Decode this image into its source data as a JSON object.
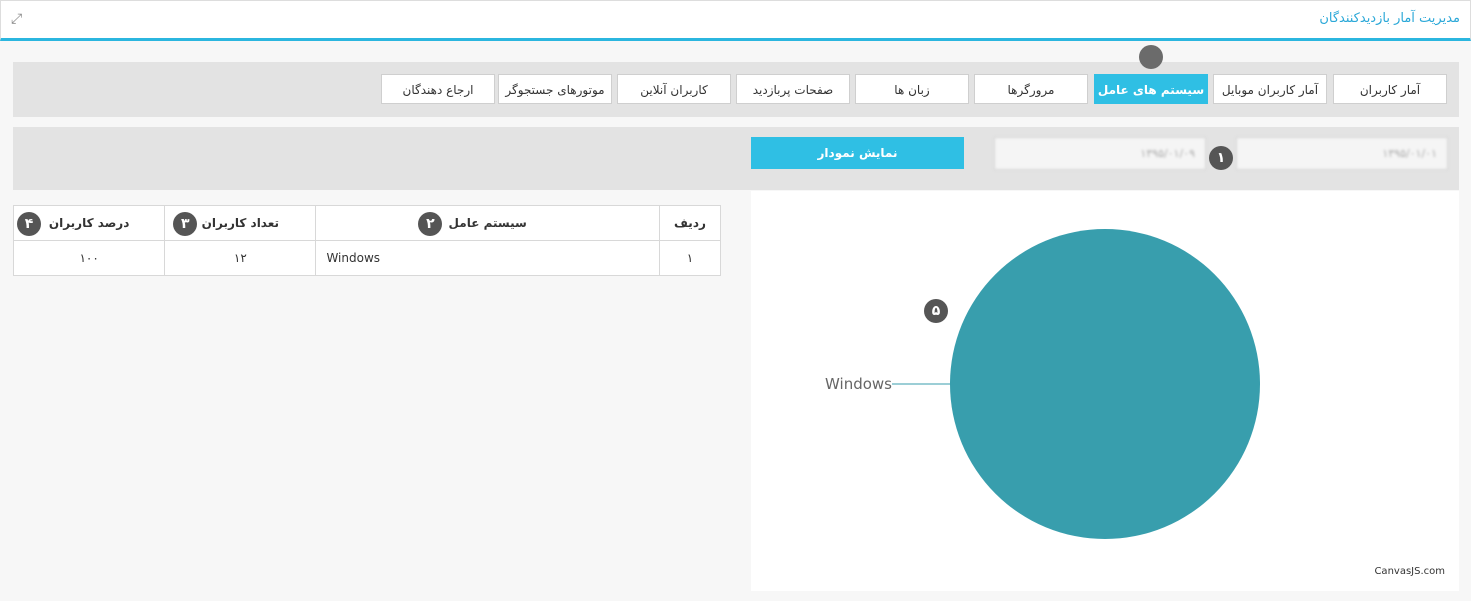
{
  "header": {
    "title": "مدیریت آمار بازدیدکنندگان",
    "expand_icon": "expand-icon"
  },
  "tabs": [
    {
      "label": "آمار کاربران",
      "active": false
    },
    {
      "label": "آمار کاربران موبایل",
      "active": false
    },
    {
      "label": "سیستم های عامل",
      "active": true
    },
    {
      "label": "مرورگرها",
      "active": false
    },
    {
      "label": "زبان ها",
      "active": false
    },
    {
      "label": "صفحات پربازدید",
      "active": false
    },
    {
      "label": "کاربران آنلاین",
      "active": false
    },
    {
      "label": "موتورهای جستجوگر",
      "active": false
    },
    {
      "label": "ارجاع دهندگان",
      "active": false
    }
  ],
  "filter": {
    "from_date": "۱۳۹۵/۰۱/۰۱",
    "to_date": "۱۳۹۵/۰۱/۰۹",
    "show_button": "نمایش نمودار"
  },
  "badges": [
    "۱",
    "۲",
    "۳",
    "۴",
    "۵"
  ],
  "table": {
    "columns": [
      "ردیف",
      "سیستم عامل",
      "تعداد کاربران",
      "درصد کاربران"
    ],
    "rows": [
      {
        "index": "۱",
        "os": "Windows",
        "count": "۱۲",
        "percent": "۱۰۰"
      }
    ]
  },
  "chart_data": {
    "type": "pie",
    "categories": [
      "Windows"
    ],
    "values": [
      100
    ],
    "colors": [
      "#389ead"
    ],
    "labels": [
      "Windows"
    ]
  },
  "chart_credit": "CanvasJS.com",
  "colors": {
    "accent": "#2fbfe4",
    "pie": "#389ead"
  }
}
